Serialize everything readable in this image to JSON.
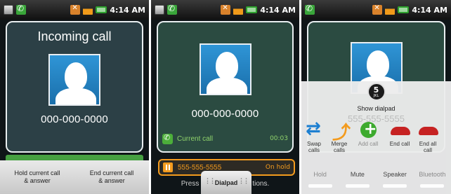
{
  "statusbar": {
    "time": "4:14 AM"
  },
  "screen1": {
    "title": "Incoming call",
    "number": "000-000-0000",
    "buttons": [
      {
        "label": "Hold current call\n& answer"
      },
      {
        "label": "End current call\n& answer"
      }
    ]
  },
  "screen2": {
    "number": "000-000-0000",
    "current_call_label": "Current call",
    "current_call_timer": "00:03",
    "held_number": "555-555-5555",
    "held_status": "On hold",
    "press_text_left": "Press",
    "press_text_right": "tions.",
    "dialpad_tab": "Dialpad"
  },
  "screen3": {
    "keypad_digit": "5",
    "keypad_letters": "JKL",
    "show_dialpad": "Show dialpad",
    "ghost_number": "555-555-5555",
    "actions": [
      {
        "label": "Swap\ncalls",
        "icon": "swap-icon"
      },
      {
        "label": "Merge\ncalls",
        "icon": "merge-icon"
      },
      {
        "label": "Add call",
        "icon": "add-icon"
      },
      {
        "label": "End call",
        "icon": "end-call-icon"
      },
      {
        "label": "End all\ncall",
        "icon": "end-all-icon"
      }
    ],
    "tabs": [
      "Hold",
      "Mute",
      "Speaker",
      "Bluetooth"
    ]
  },
  "colors": {
    "accent_green": "#46a041",
    "hold_orange": "#f39b1e",
    "end_red": "#c62222"
  }
}
